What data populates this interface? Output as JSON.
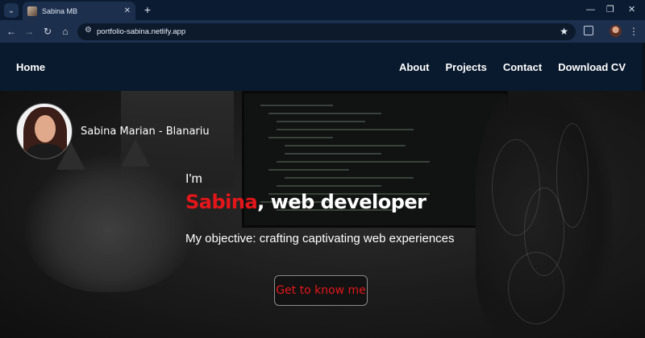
{
  "browser": {
    "tab_title": "Sabina MB",
    "tab_search_icon": "chevron-down-icon",
    "close_glyph": "✕",
    "new_tab_glyph": "+",
    "url": "portfolio-sabina.netlify.app",
    "window_controls": {
      "minimize": "—",
      "restore": "❐",
      "close": "✕"
    },
    "nav_glyphs": {
      "back": "←",
      "forward": "→",
      "reload": "↻",
      "home": "⌂",
      "menu": "⋮",
      "bookmark": "★",
      "site_info": "⚙"
    }
  },
  "site": {
    "nav_home": "Home",
    "nav_links": [
      "About",
      "Projects",
      "Contact",
      "Download CV"
    ],
    "owner_name": "Sabina Marian - Blanariu",
    "hero": {
      "intro": "I'm",
      "name": "Sabina",
      "role": ", web developer",
      "objective": "My objective: crafting captivating web experiences",
      "cta": "Get to know me"
    }
  },
  "colors": {
    "accent_red": "#e4161a",
    "header_bg": "#0a1a2e",
    "chrome_bg": "#1c2f4d"
  }
}
